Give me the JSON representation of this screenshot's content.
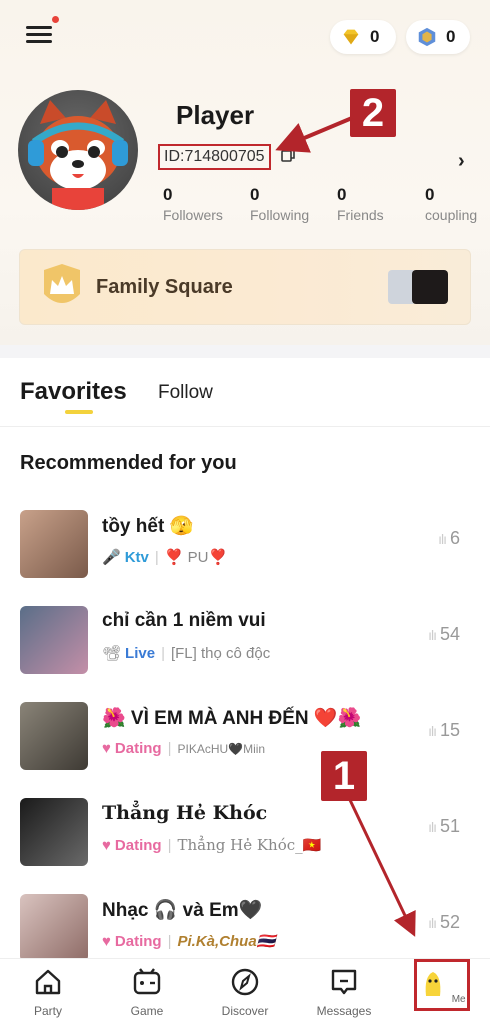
{
  "header": {
    "gem_count": "0",
    "coin_count": "0",
    "username": "Player",
    "user_id": "ID:714800705",
    "stats": [
      {
        "value": "0",
        "label": "Followers"
      },
      {
        "value": "0",
        "label": "Following"
      },
      {
        "value": "0",
        "label": "Friends"
      },
      {
        "value": "0",
        "label": "coupling"
      }
    ],
    "family_label": "Family Square"
  },
  "tabs": {
    "favorites": "Favorites",
    "follow": "Follow"
  },
  "section_title": "Recommended for you",
  "rooms": [
    {
      "name": "tồy hết 🫣",
      "tag": "Ktv",
      "tag_color": "#2f9bd8",
      "desc": "❣️ PU❣️",
      "count": "6"
    },
    {
      "name": "chỉ cần 1 niềm vui",
      "tag": "Live",
      "tag_color": "#3a7bd5",
      "desc": "[FL] thọ cô độc",
      "count": "54"
    },
    {
      "name": "🌺 VÌ EM MÀ ANH ĐẾN ❤️🌺",
      "tag": "Dating",
      "tag_color": "#e76aa0",
      "desc": "PIKAcHU🖤Miin",
      "count": "15"
    },
    {
      "name": "Thẳng He̓ Khóc",
      "tag": "Dating",
      "tag_color": "#e76aa0",
      "desc": "Thẳng He̓ Khóc_🇻🇳",
      "count": "51"
    },
    {
      "name": "Nhạc 🎧 và Em🖤",
      "tag": "Dating",
      "tag_color": "#e76aa0",
      "desc": "Pi.Kà,Chua🇹🇭",
      "count": "52"
    }
  ],
  "nav": [
    {
      "label": "Party",
      "icon": "home-icon"
    },
    {
      "label": "Game",
      "icon": "gamepad-icon"
    },
    {
      "label": "Discover",
      "icon": "compass-icon"
    },
    {
      "label": "Messages",
      "icon": "message-icon"
    },
    {
      "label": "Me",
      "icon": "me-icon"
    }
  ],
  "annotations": {
    "one": "1",
    "two": "2"
  },
  "colors": {
    "accent_yellow": "#f3d23c",
    "annotation_red": "#b3252b"
  }
}
